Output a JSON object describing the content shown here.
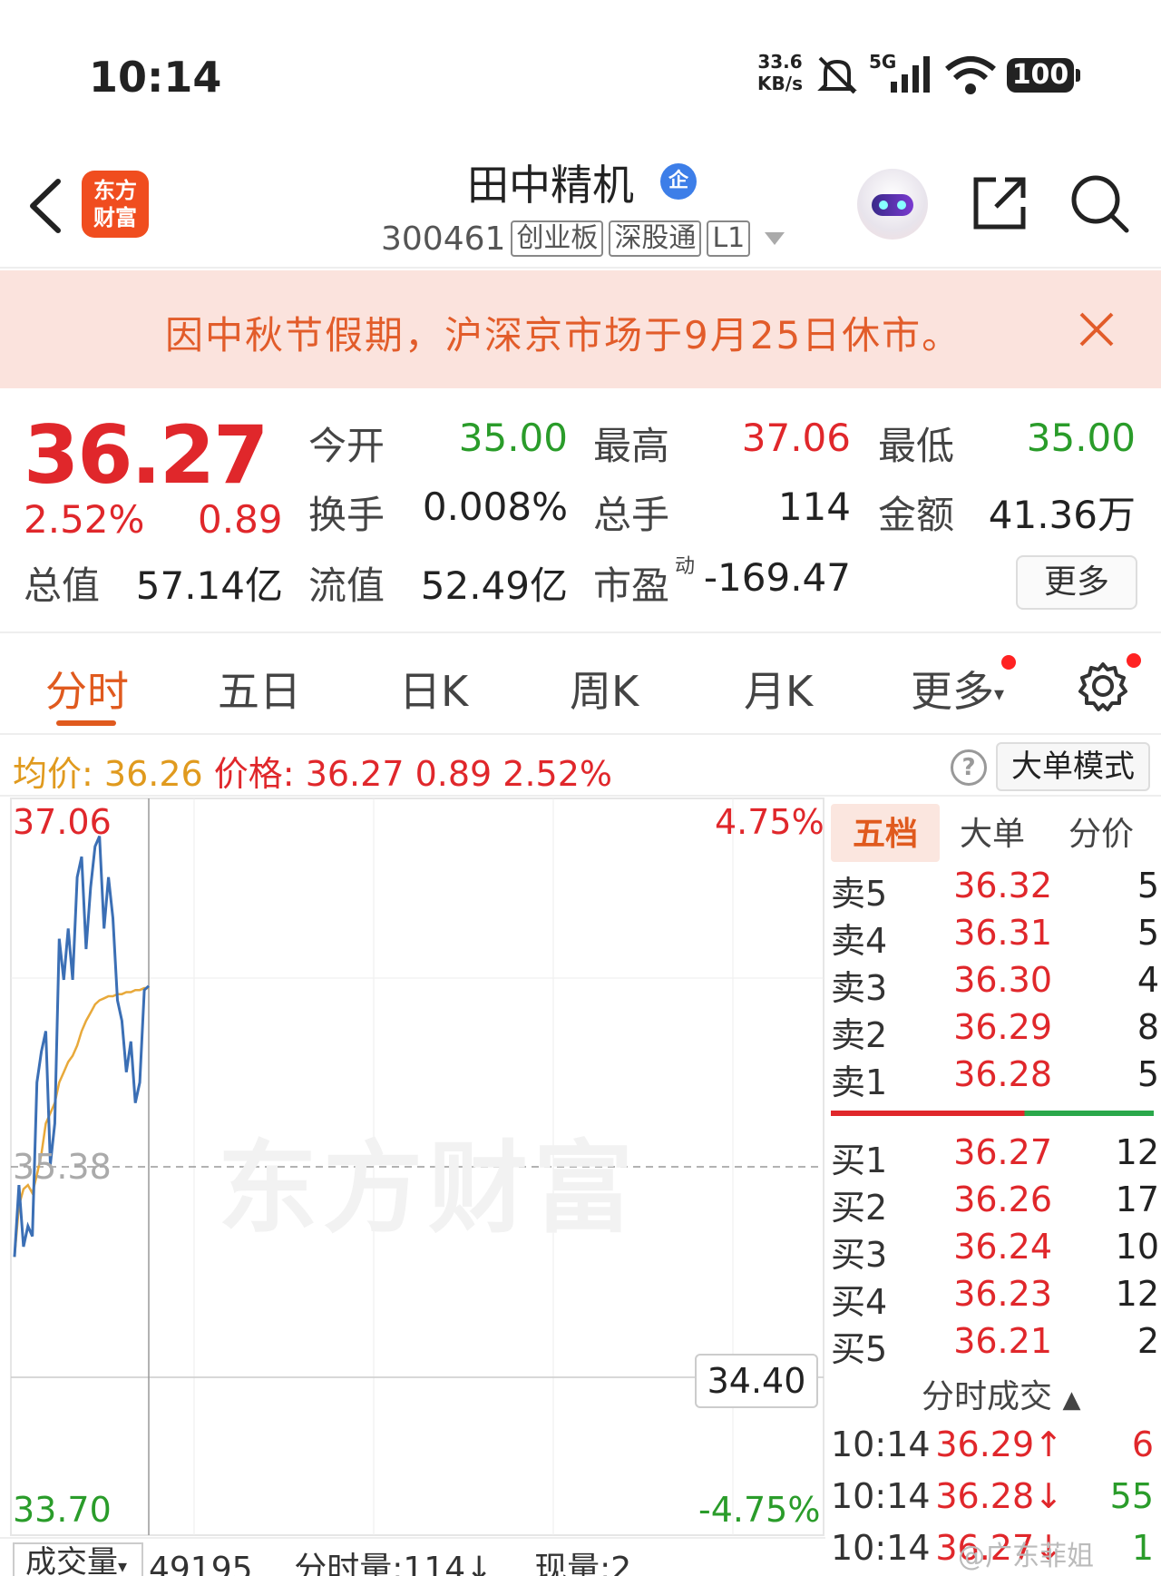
{
  "status": {
    "time": "10:14",
    "net_speed_value": "33.6",
    "net_speed_unit": "KB/s",
    "network": "5G",
    "battery": "100"
  },
  "header": {
    "app_logo_line1": "东方",
    "app_logo_line2": "财富",
    "stock_name": "田中精机",
    "name_badge": "企",
    "stock_code": "300461",
    "tags": [
      "创业板",
      "深股通",
      "L1"
    ]
  },
  "notice": {
    "text": "因中秋节假期，沪深京市场于9月25日休市。"
  },
  "quote": {
    "last_price": "36.27",
    "change_pct": "2.52%",
    "change_amt": "0.89",
    "fields": [
      {
        "label": "今开",
        "value": "35.00",
        "color": "green"
      },
      {
        "label": "最高",
        "value": "37.06",
        "color": "red"
      },
      {
        "label": "最低",
        "value": "35.00",
        "color": "green"
      },
      {
        "label": "换手",
        "value": "0.008%",
        "color": "black"
      },
      {
        "label": "总手",
        "value": "114",
        "color": "black"
      },
      {
        "label": "金额",
        "value": "41.36万",
        "color": "black"
      },
      {
        "label": "总值",
        "value": "57.14亿",
        "color": "black"
      },
      {
        "label": "流值",
        "value": "52.49亿",
        "color": "black"
      },
      {
        "label": "市盈",
        "value": "-169.47",
        "color": "black"
      }
    ],
    "pe_superscript": "动",
    "more_label": "更多"
  },
  "tabs": [
    {
      "label": "分时",
      "active": true
    },
    {
      "label": "五日",
      "active": false
    },
    {
      "label": "日K",
      "active": false
    },
    {
      "label": "周K",
      "active": false
    },
    {
      "label": "月K",
      "active": false
    },
    {
      "label": "更多",
      "active": false
    }
  ],
  "avg_bar": {
    "avg_label": "均价:",
    "avg_value": "36.26",
    "price_label": "价格:",
    "price_value": "36.27",
    "chg_amt": "0.89",
    "chg_pct": "2.52%",
    "help": "?",
    "big_order_mode": "大单模式"
  },
  "chart_data": {
    "type": "line",
    "y_labels": {
      "top": "37.06",
      "mid": "35.38",
      "bottom": "33.70"
    },
    "pct_labels": {
      "top": "4.75%",
      "bottom": "-4.75%"
    },
    "ylim": [
      33.7,
      37.06
    ],
    "reference": 35.38,
    "price_marker": "34.40",
    "watermark": "东方财富",
    "series": [
      {
        "values": [
          34.95,
          35.3,
          35.0,
          35.1,
          35.05,
          35.8,
          35.95,
          36.05,
          35.4,
          35.6,
          36.5,
          36.3,
          36.55,
          36.3,
          36.8,
          36.9,
          36.45,
          36.75,
          36.95,
          37.0,
          36.55,
          36.8,
          36.6,
          36.2,
          36.1,
          35.85,
          36.0,
          35.7,
          35.8,
          36.25,
          36.27
        ]
      },
      {
        "values": [
          34.95,
          35.2,
          35.28,
          35.3,
          35.26,
          35.35,
          35.45,
          35.6,
          35.65,
          35.7,
          35.8,
          35.85,
          35.9,
          35.93,
          35.98,
          36.05,
          36.1,
          36.14,
          36.18,
          36.2,
          36.21,
          36.22,
          36.22,
          36.23,
          36.23,
          36.24,
          36.24,
          36.25,
          36.25,
          36.26,
          36.26
        ]
      }
    ]
  },
  "order_book": {
    "tabs": [
      "五档",
      "大单",
      "分价"
    ],
    "asks": [
      {
        "label": "卖5",
        "price": "36.32",
        "vol": "5"
      },
      {
        "label": "卖4",
        "price": "36.31",
        "vol": "5"
      },
      {
        "label": "卖3",
        "price": "36.30",
        "vol": "4"
      },
      {
        "label": "卖2",
        "price": "36.29",
        "vol": "8"
      },
      {
        "label": "卖1",
        "price": "36.28",
        "vol": "5"
      }
    ],
    "bids": [
      {
        "label": "买1",
        "price": "36.27",
        "vol": "12"
      },
      {
        "label": "买2",
        "price": "36.26",
        "vol": "17"
      },
      {
        "label": "买3",
        "price": "36.24",
        "vol": "10"
      },
      {
        "label": "买4",
        "price": "36.23",
        "vol": "12"
      },
      {
        "label": "买5",
        "price": "36.21",
        "vol": "2"
      }
    ],
    "ticks_title": "分时成交",
    "ticks": [
      {
        "time": "10:14",
        "price": "36.29↑",
        "vol": "6",
        "dir": "up"
      },
      {
        "time": "10:14",
        "price": "36.28↓",
        "vol": "55",
        "dir": "down"
      },
      {
        "time": "10:14",
        "price": "36.27↓",
        "vol": "1",
        "dir": "down"
      }
    ]
  },
  "volume_bar": {
    "selector": "成交量",
    "text": "49195    分时量:114↓    现量:2"
  },
  "weibo_mark": "@广东菲姐"
}
